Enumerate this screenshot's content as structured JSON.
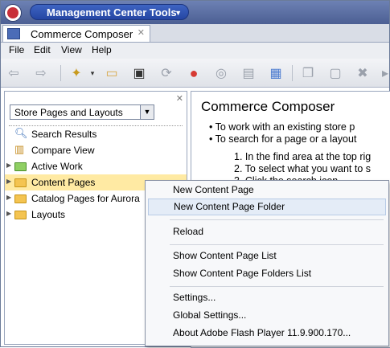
{
  "app": {
    "title": "Management Center Tools"
  },
  "tab": {
    "label": "Commerce Composer"
  },
  "menubar": {
    "items": [
      "File",
      "Edit",
      "View",
      "Help"
    ]
  },
  "left_panel": {
    "view_select": "Store Pages and Layouts",
    "tree": [
      {
        "label": "Search Results",
        "icon": "search-icon"
      },
      {
        "label": "Compare View",
        "icon": "compare-icon"
      },
      {
        "label": "Active Work",
        "icon": "active-work-icon"
      },
      {
        "label": "Content Pages",
        "icon": "folder-icon",
        "selected": true
      },
      {
        "label": "Catalog Pages for Aurora",
        "icon": "folder-icon"
      },
      {
        "label": "Layouts",
        "icon": "folder-icon"
      }
    ]
  },
  "right_panel": {
    "title": "Commerce Composer",
    "bullets": [
      "To work with an existing store p",
      "To search for a page or a layout"
    ],
    "steps": [
      "1. In the find area at the top rig",
      "2. To select what you want to s",
      "3. Click the search icon"
    ]
  },
  "context_menu": {
    "items": [
      "New Content Page",
      "New Content Page Folder",
      "Reload",
      "Show Content Page List",
      "Show Content Page Folders List",
      "Settings...",
      "Global Settings...",
      "About Adobe Flash Player 11.9.900.170..."
    ],
    "highlighted": "New Content Page Folder"
  },
  "colors": {
    "title_bar": "#4c5f93",
    "selection": "#ffeaa3",
    "menu_highlight": "#e4ecf7"
  }
}
